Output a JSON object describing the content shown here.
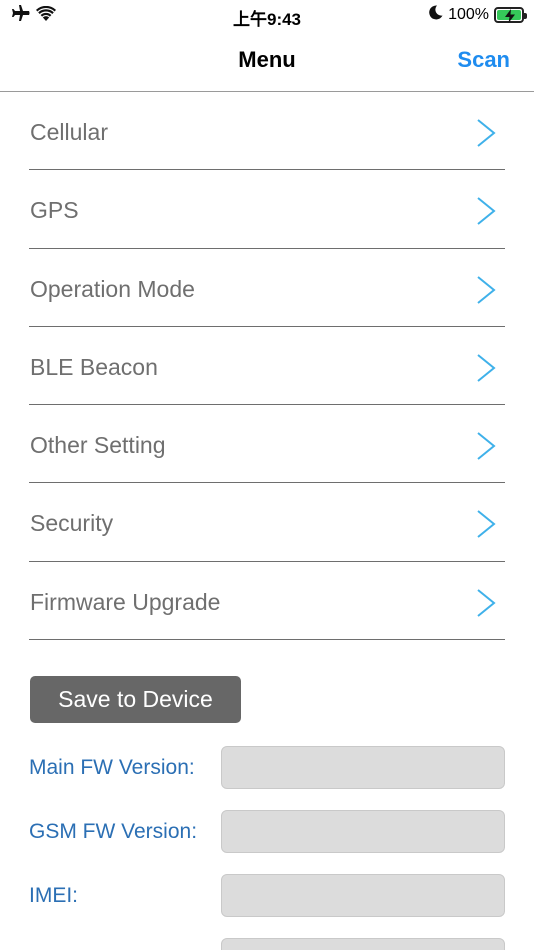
{
  "status_bar": {
    "time": "上午9:43",
    "battery_percent": "100%",
    "airplane_icon": "airplane-icon",
    "wifi_icon": "wifi-icon",
    "moon_icon": "moon-icon",
    "battery_icon": "battery-charging-icon",
    "battery_level": 1.0
  },
  "nav": {
    "title": "Menu",
    "scan_label": "Scan"
  },
  "menu": {
    "items": [
      {
        "label": "Cellular"
      },
      {
        "label": "GPS"
      },
      {
        "label": "Operation Mode"
      },
      {
        "label": "BLE Beacon"
      },
      {
        "label": "Other Setting"
      },
      {
        "label": "Security"
      },
      {
        "label": "Firmware Upgrade"
      }
    ],
    "chevron_icon": "chevron-right-icon"
  },
  "save_button": {
    "label": "Save to Device"
  },
  "info": {
    "main_fw": {
      "label": "Main FW Version:",
      "value": ""
    },
    "gsm_fw": {
      "label": "GSM FW Version:",
      "value": ""
    },
    "imei": {
      "label": "IMEI:",
      "value": ""
    },
    "extra": {
      "value": ""
    }
  },
  "colors": {
    "accent": "#1f8cef",
    "chevron": "#3fb1ea",
    "info_label": "#2b6fb4",
    "button_bg": "#676767",
    "field_bg": "#dcdcdc"
  }
}
